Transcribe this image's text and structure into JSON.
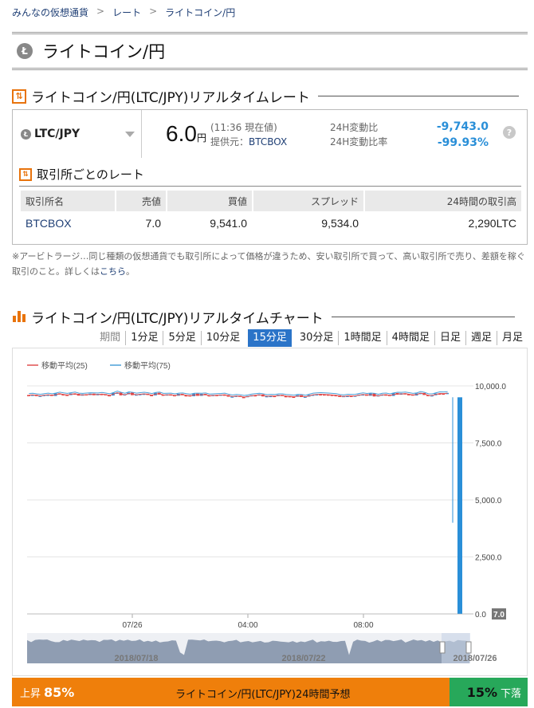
{
  "breadcrumb": [
    "みんなの仮想通貨",
    "レート",
    "ライトコイン/円"
  ],
  "page_title": "ライトコイン/円",
  "rate_section": {
    "heading": "ライトコイン/円(LTC/JPY)リアルタイムレート",
    "pair": "LTC/JPY",
    "price": "6.0",
    "price_unit": "円",
    "time_note": "(11:36 現在値)",
    "provider_label": "提供元：",
    "provider": "BTCBOX",
    "change_label": "24H変動比",
    "change_rate_label": "24H変動比率",
    "change": "-9,743.0",
    "change_rate": "-99.93%",
    "help": "?"
  },
  "exchange_section": {
    "heading": "取引所ごとのレート",
    "columns": [
      "取引所名",
      "売値",
      "買値",
      "スプレッド",
      "24時間の取引高"
    ],
    "rows": [
      {
        "exchange": "BTCBOX",
        "sell": "7.0",
        "buy": "9,541.0",
        "spread": "9,534.0",
        "volume": "2,290LTC"
      }
    ]
  },
  "note": {
    "text": "※アービトラージ…同じ種類の仮想通貨でも取引所によって価格が違うため、安い取引所で買って、高い取引所で売り、差額を稼ぐ取引のこと。詳しくは",
    "link": "こちら",
    "end": "。"
  },
  "chart_section": {
    "heading": "ライトコイン/円(LTC/JPY)リアルタイムチャート",
    "period_label": "期間",
    "tabs": [
      "1分足",
      "5分足",
      "10分足",
      "15分足",
      "30分足",
      "1時間足",
      "4時間足",
      "日足",
      "週足",
      "月足"
    ],
    "active_tab": "15分足"
  },
  "chart_data": {
    "type": "candlestick",
    "legend": [
      {
        "name": "移動平均(25)",
        "color": "#e05050"
      },
      {
        "name": "移動平均(75)",
        "color": "#4aa0d8"
      }
    ],
    "y_ticks": [
      "10,000.0",
      "7,500.0",
      "5,000.0",
      "2,500.0",
      "0.0"
    ],
    "ylim": [
      0,
      10000
    ],
    "x_ticks": [
      "07/26",
      "04:00",
      "08:00"
    ],
    "last_value": "7.0",
    "navigator_labels": [
      "2018/07/18",
      "2018/07/22",
      "2018/07/26"
    ],
    "colors": {
      "up": "#2a8fd8",
      "down": "#e04040"
    },
    "price_level_approx": 9600,
    "final_drop_to": 7
  },
  "prediction": {
    "up_label": "上昇",
    "up_pct": "85%",
    "title": "ライトコイン/円(LTC/JPY)24時間予想",
    "down_pct": "15%",
    "down_label": "下落"
  }
}
